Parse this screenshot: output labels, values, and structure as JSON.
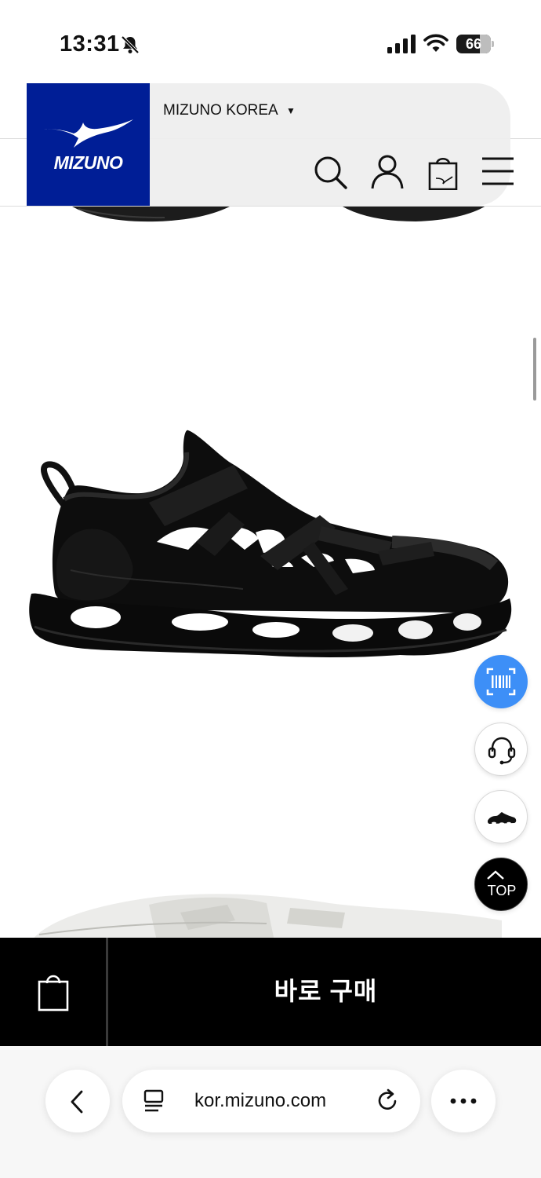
{
  "status_bar": {
    "time": "13:31",
    "battery": "66",
    "icons": [
      "bell-slash-icon",
      "signal-icon",
      "wifi-icon",
      "battery-icon"
    ]
  },
  "header": {
    "logo_text": "MIZUNO",
    "region": "MIZUNO KOREA",
    "region_caret": "▼",
    "brand_color": "#001e96",
    "icons": [
      "search-icon",
      "account-icon",
      "shopping-bag-icon",
      "menu-icon"
    ]
  },
  "floating_buttons": {
    "barcode": "barcode-scan-icon",
    "support": "headset-icon",
    "recent": "recent-product-icon",
    "top_label": "TOP",
    "accent_color": "#3d8ff7"
  },
  "buy_bar": {
    "cart_icon": "shopping-bag-icon",
    "buy_now": "바로 구매"
  },
  "browser": {
    "url": "kor.mizuno.com",
    "icons": [
      "back-arrow-icon",
      "reader-icon",
      "reload-icon",
      "more-icon"
    ]
  }
}
